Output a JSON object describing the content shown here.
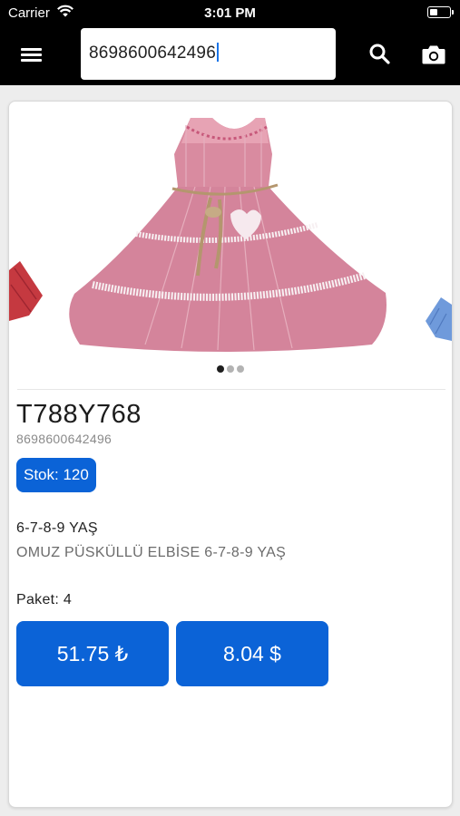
{
  "status_bar": {
    "carrier": "Carrier",
    "time": "3:01 PM"
  },
  "header": {
    "search_value": "8698600642496",
    "icons": [
      "hamburger-menu-icon",
      "search-icon",
      "camera-icon"
    ],
    "background": "#000000"
  },
  "product": {
    "code": "T788Y768",
    "barcode": "8698600642496",
    "stock_label": "Stok: 120",
    "size": "6-7-8-9 YAŞ",
    "description": "OMUZ PÜSKÜLLÜ ELBİSE 6-7-8-9 YAŞ",
    "package_label": "Paket: 4",
    "price_try": "51.75 ₺",
    "price_usd": "8.04 $",
    "image_count": 3,
    "active_image": 1
  },
  "colors": {
    "accent": "#0b63d7",
    "dress_pink": "#d8889e"
  }
}
